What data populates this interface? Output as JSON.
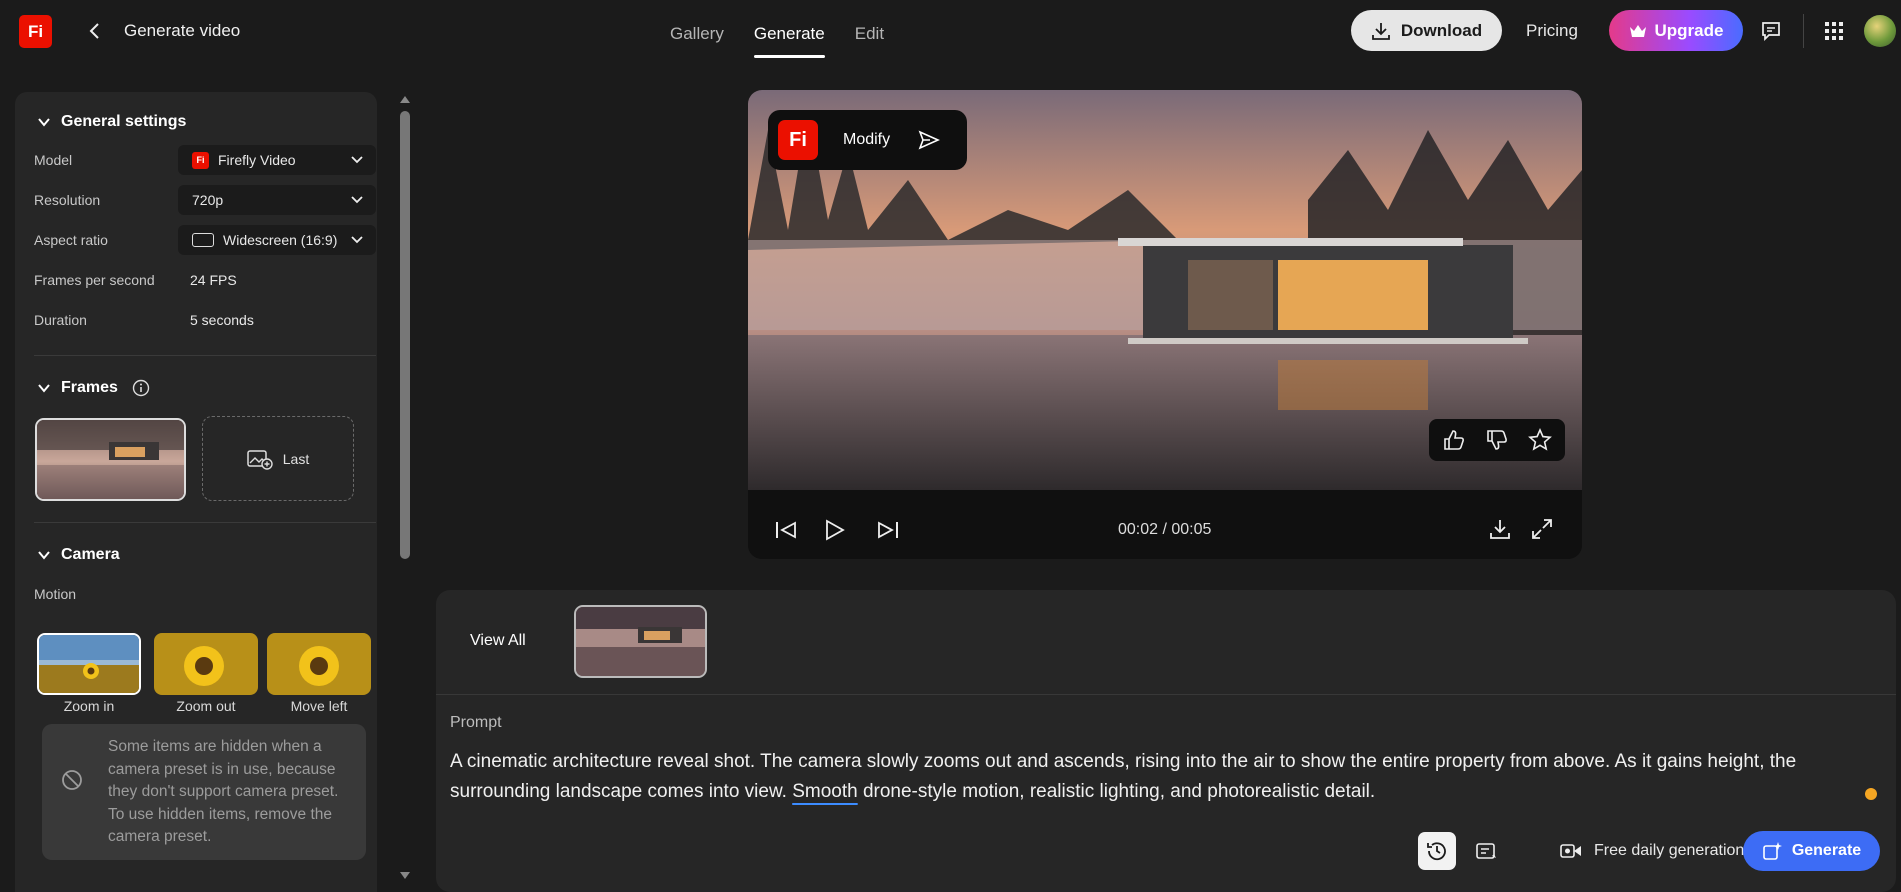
{
  "app": {
    "logo_text": "Fi",
    "title": "Generate video"
  },
  "nav": {
    "tabs": [
      "Gallery",
      "Generate",
      "Edit"
    ],
    "active": "Generate"
  },
  "header": {
    "download_label": "Download",
    "pricing_label": "Pricing",
    "upgrade_label": "Upgrade"
  },
  "general": {
    "title": "General settings",
    "model_label": "Model",
    "model_value": "Firefly Video",
    "resolution_label": "Resolution",
    "resolution_value": "720p",
    "aspect_label": "Aspect ratio",
    "aspect_value": "Widescreen (16:9)",
    "fps_label": "Frames per second",
    "fps_value": "24 FPS",
    "duration_label": "Duration",
    "duration_value": "5 seconds"
  },
  "frames": {
    "title": "Frames",
    "last_label": "Last"
  },
  "camera": {
    "title": "Camera",
    "motion_label": "Motion",
    "presets": [
      "Zoom in",
      "Zoom out",
      "Move left"
    ],
    "tooltip": "Some items are hidden when a camera preset is in use, because they don't support camera preset. To use hidden items, remove the camera preset."
  },
  "video": {
    "modify_label": "Modify",
    "time": "00:02 / 00:05",
    "progress": 0.565
  },
  "history": {
    "view_all_label": "View All"
  },
  "prompt": {
    "label": "Prompt",
    "text_before": "A cinematic architecture reveal shot. The camera slowly zooms out and ascends, rising into the air to show the entire property from above. As it gains height, the surrounding landscape comes into view. ",
    "text_highlight": "Smooth",
    "text_after": " drone-style motion, realistic lighting, and photorealistic detail."
  },
  "footer": {
    "free_label": "Free daily generations",
    "generate_label": "Generate"
  },
  "colors": {
    "brand": "#eb1000",
    "accent": "#3d6cf5",
    "status_dot": "#f5a623"
  }
}
